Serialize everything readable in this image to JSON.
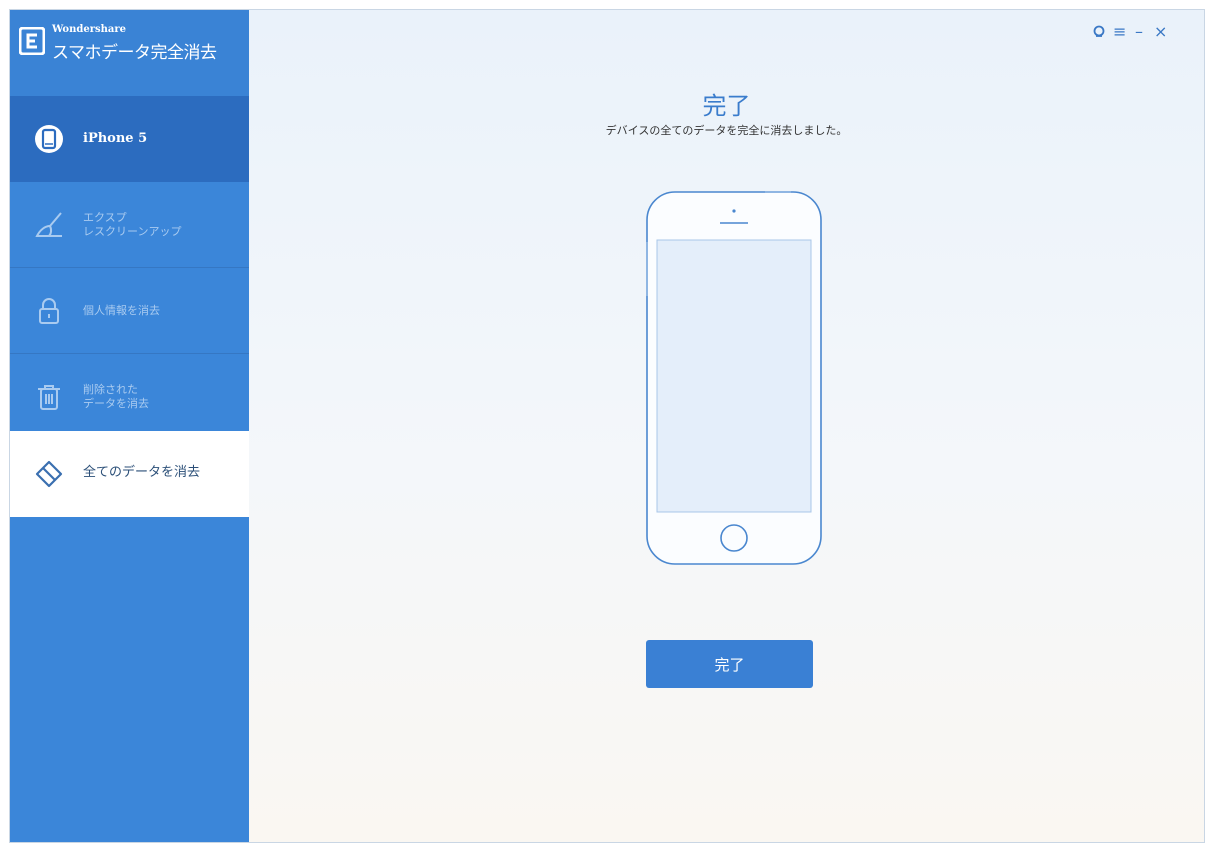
{
  "brand": {
    "company": "Wondershare",
    "product": "スマホデータ完全消去",
    "logo_icon": "wondershare-logo-icon"
  },
  "sidebar": {
    "device": {
      "label": "iPhone 5",
      "icon": "phone-icon"
    },
    "items": [
      {
        "label": "エクスプ\nレスクリーンアップ",
        "icon": "broom-icon"
      },
      {
        "label": "個人情報を消去",
        "icon": "lock-icon"
      },
      {
        "label": "削除された\nデータを消去",
        "icon": "trash-icon"
      },
      {
        "label": "全てのデータを消去",
        "icon": "eraser-icon",
        "active": true
      }
    ]
  },
  "window_controls": {
    "feedback": "feedback-icon",
    "menu": "menu-icon",
    "minimize": "minimize-icon",
    "close": "close-icon",
    "menu_glyph": "≡",
    "minimize_glyph": "–",
    "close_glyph": "×"
  },
  "main": {
    "title": "完了",
    "subtitle": "デバイスの全てのデータを完全に消去しました。",
    "button_label": "完了"
  },
  "colors": {
    "sidebar": "#3b86d9",
    "sidebar_device": "#2c6cbf",
    "accent": "#3a80d4"
  }
}
